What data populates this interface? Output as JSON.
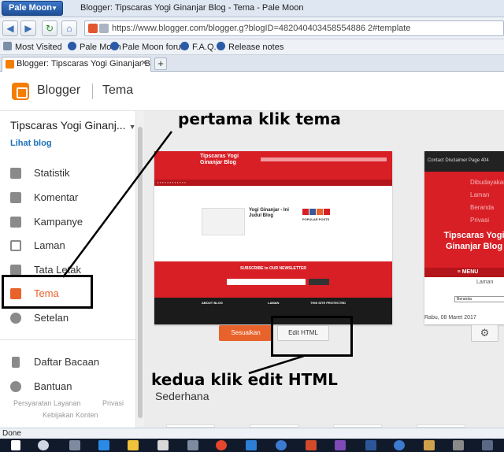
{
  "browser": {
    "menu_button": "Pale Moon",
    "window_title": "Blogger: Tipscaras Yogi Ginanjar Blog - Tema - Pale Moon",
    "url": "https://www.blogger.com/blogger.g?blogID=482040403458554886 2#template",
    "bookmarks": [
      "Most Visited",
      "Pale Moon",
      "Pale Moon forum",
      "F.A.Q.",
      "Release notes"
    ],
    "tab_label": "Blogger: Tipscaras Yogi Ginanjar Blog...",
    "status_text": "Done"
  },
  "header": {
    "app_name": "Blogger",
    "section": "Tema"
  },
  "sidebar": {
    "blog_name": "Tipscaras Yogi Ginanj...",
    "view_blog": "Lihat blog",
    "items": [
      {
        "label": "Statistik"
      },
      {
        "label": "Komentar"
      },
      {
        "label": "Kampanye"
      },
      {
        "label": "Laman"
      },
      {
        "label": "Tata Letak"
      },
      {
        "label": "Tema"
      },
      {
        "label": "Setelan"
      },
      {
        "label": "Daftar Bacaan"
      },
      {
        "label": "Bantuan"
      }
    ],
    "footer_links": [
      "Persyaratan Layanan",
      "Privasi",
      "Kebijakan Konten"
    ]
  },
  "main": {
    "live_preview": {
      "title": "Tipscaras Yogi Ginanjar Blog",
      "post_title": "Yogi Ginanjar - Ini Judul Blog",
      "widget_title": "POPULAR POSTS",
      "newsletter": "SUBSCRIBE to OUR NEWSLETTER",
      "footer_left": "ABOUT BLOG",
      "footer_mid": "LAMAN",
      "footer_right": "THIS SITE PROTECTED"
    },
    "mobile_preview": {
      "top_links": "Contact  Disclaimer  Page 404",
      "side_links": [
        "Dibudayakan oleh",
        "Laman",
        "Beranda",
        "Privasi"
      ],
      "title": "Tipscaras Yogi Ginanjar Blog",
      "menu": "≡ MENU",
      "laman": "Laman",
      "select": "Beranda",
      "date": "Rabu, 08 Maret 2017"
    },
    "customize_button": "Sesuaikan",
    "edit_html_button": "Edit HTML",
    "section_title": "Sederhana"
  },
  "annotations": {
    "first": "pertama klik tema",
    "second": "kedua klik edit HTML"
  },
  "colors": {
    "accent": "#e8622b",
    "blogger_orange": "#f57d00",
    "theme_red": "#d81f26"
  }
}
